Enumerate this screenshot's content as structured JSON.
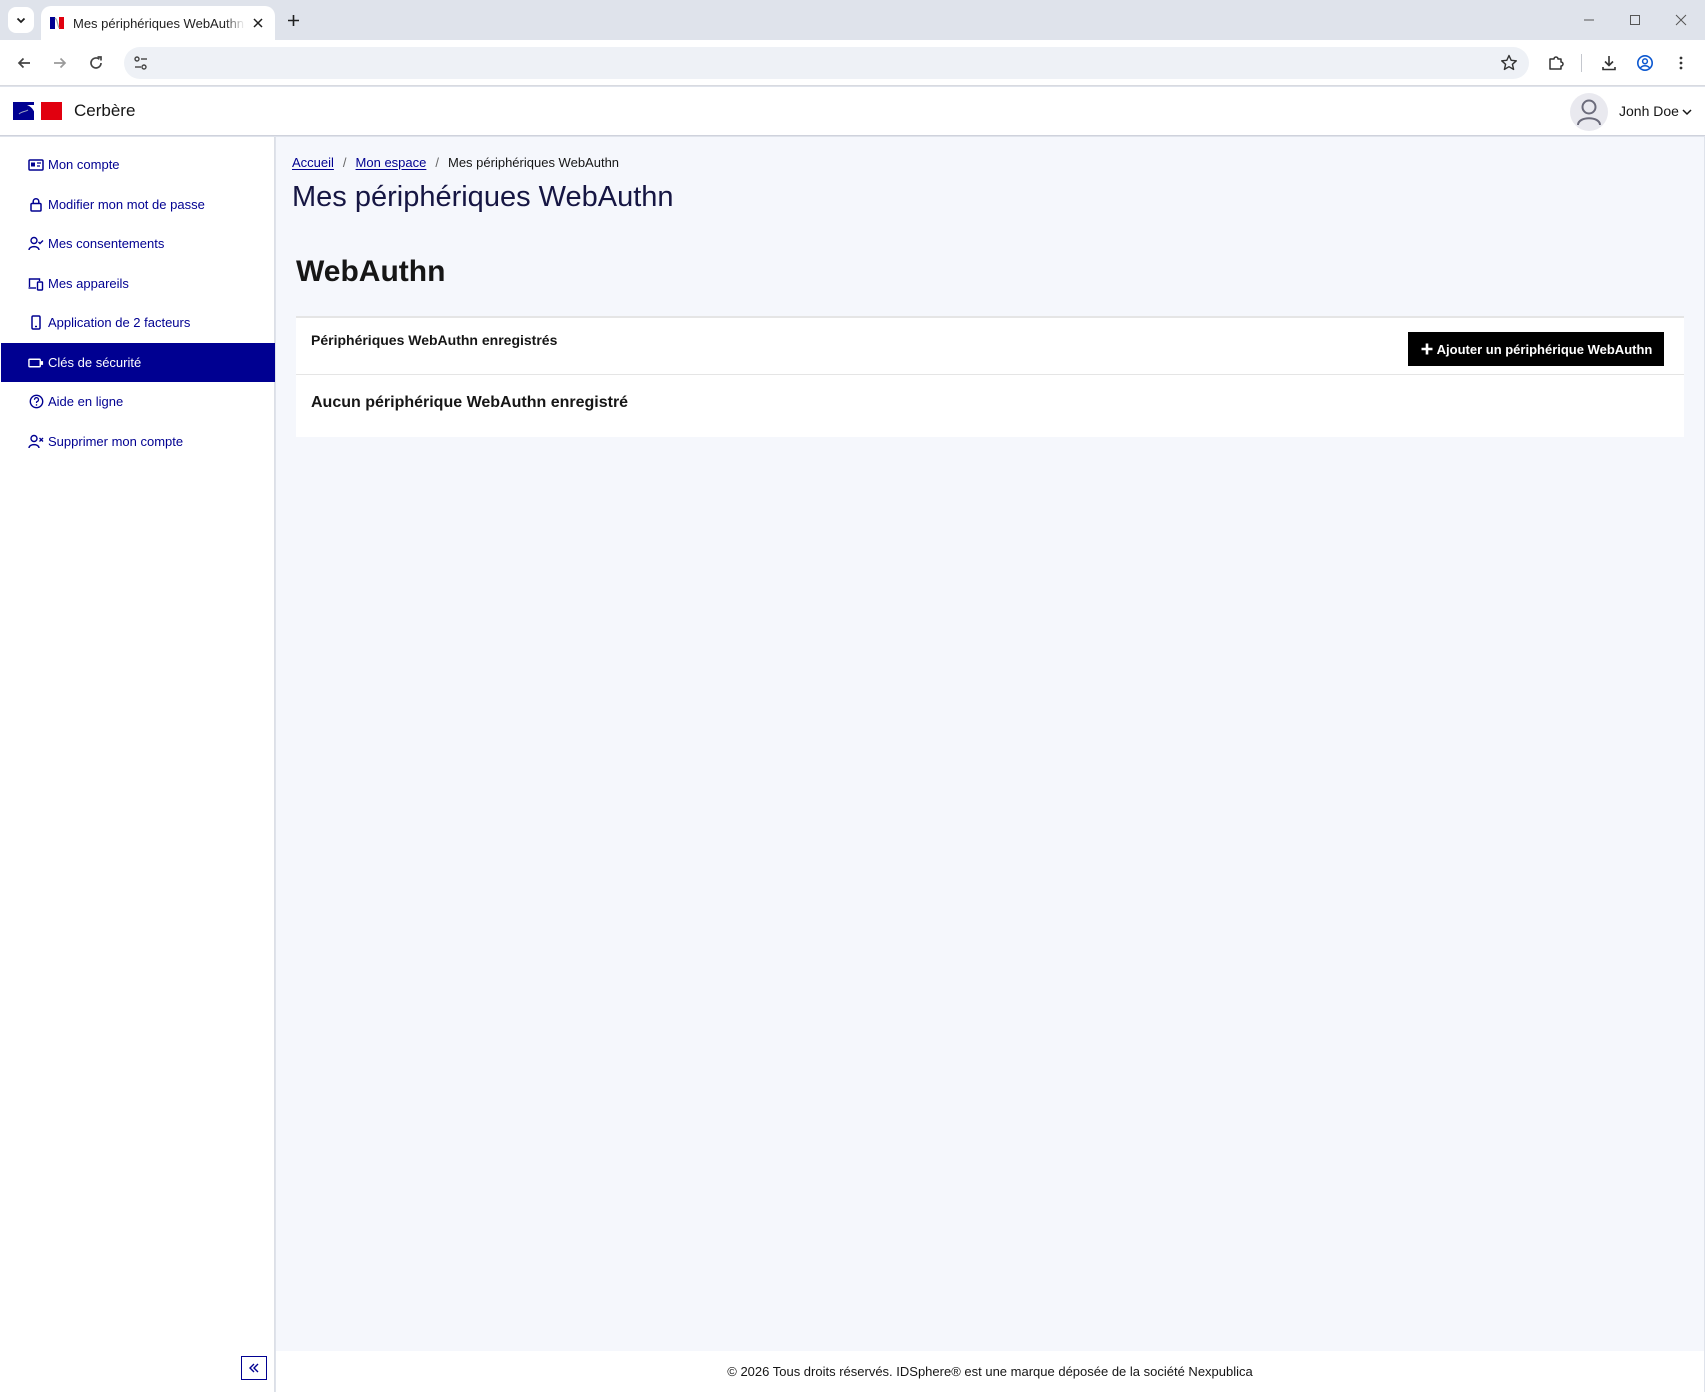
{
  "browser": {
    "tab_title": "Mes périphériques WebAuthn - Cerbère",
    "address": ""
  },
  "app": {
    "brand": "Cerbère",
    "user_name": "Jonh Doe",
    "colors": {
      "primary": "#000091",
      "flag_blue": "#000091",
      "flag_red": "#e1000f",
      "main_bg": "#f5f7fc"
    }
  },
  "sidebar": {
    "items": [
      {
        "label": "Mon compte",
        "icon": "id-card-icon"
      },
      {
        "label": "Modifier mon mot de passe",
        "icon": "lock-icon"
      },
      {
        "label": "Mes consentements",
        "icon": "user-check-icon"
      },
      {
        "label": "Mes appareils",
        "icon": "devices-icon"
      },
      {
        "label": "Application de 2 facteurs",
        "icon": "smartphone-icon"
      },
      {
        "label": "Clés de sécurité",
        "icon": "security-key-icon",
        "active": true
      },
      {
        "label": "Aide en ligne",
        "icon": "question-circle-icon"
      },
      {
        "label": "Supprimer mon compte",
        "icon": "user-x-icon"
      }
    ]
  },
  "breadcrumb": {
    "home": "Accueil",
    "space": "Mon espace",
    "current": "Mes périphériques WebAuthn",
    "separator": "/"
  },
  "page": {
    "title": "Mes périphériques WebAuthn",
    "section_title": "WebAuthn",
    "card_title": "Périphériques WebAuthn enregistrés",
    "add_button": "Ajouter un périphérique WebAuthn",
    "empty_message": "Aucun périphérique WebAuthn enregistré"
  },
  "footer": {
    "text": "© 2026 Tous droits réservés. IDSphere® est une marque déposée de la société Nexpublica"
  }
}
